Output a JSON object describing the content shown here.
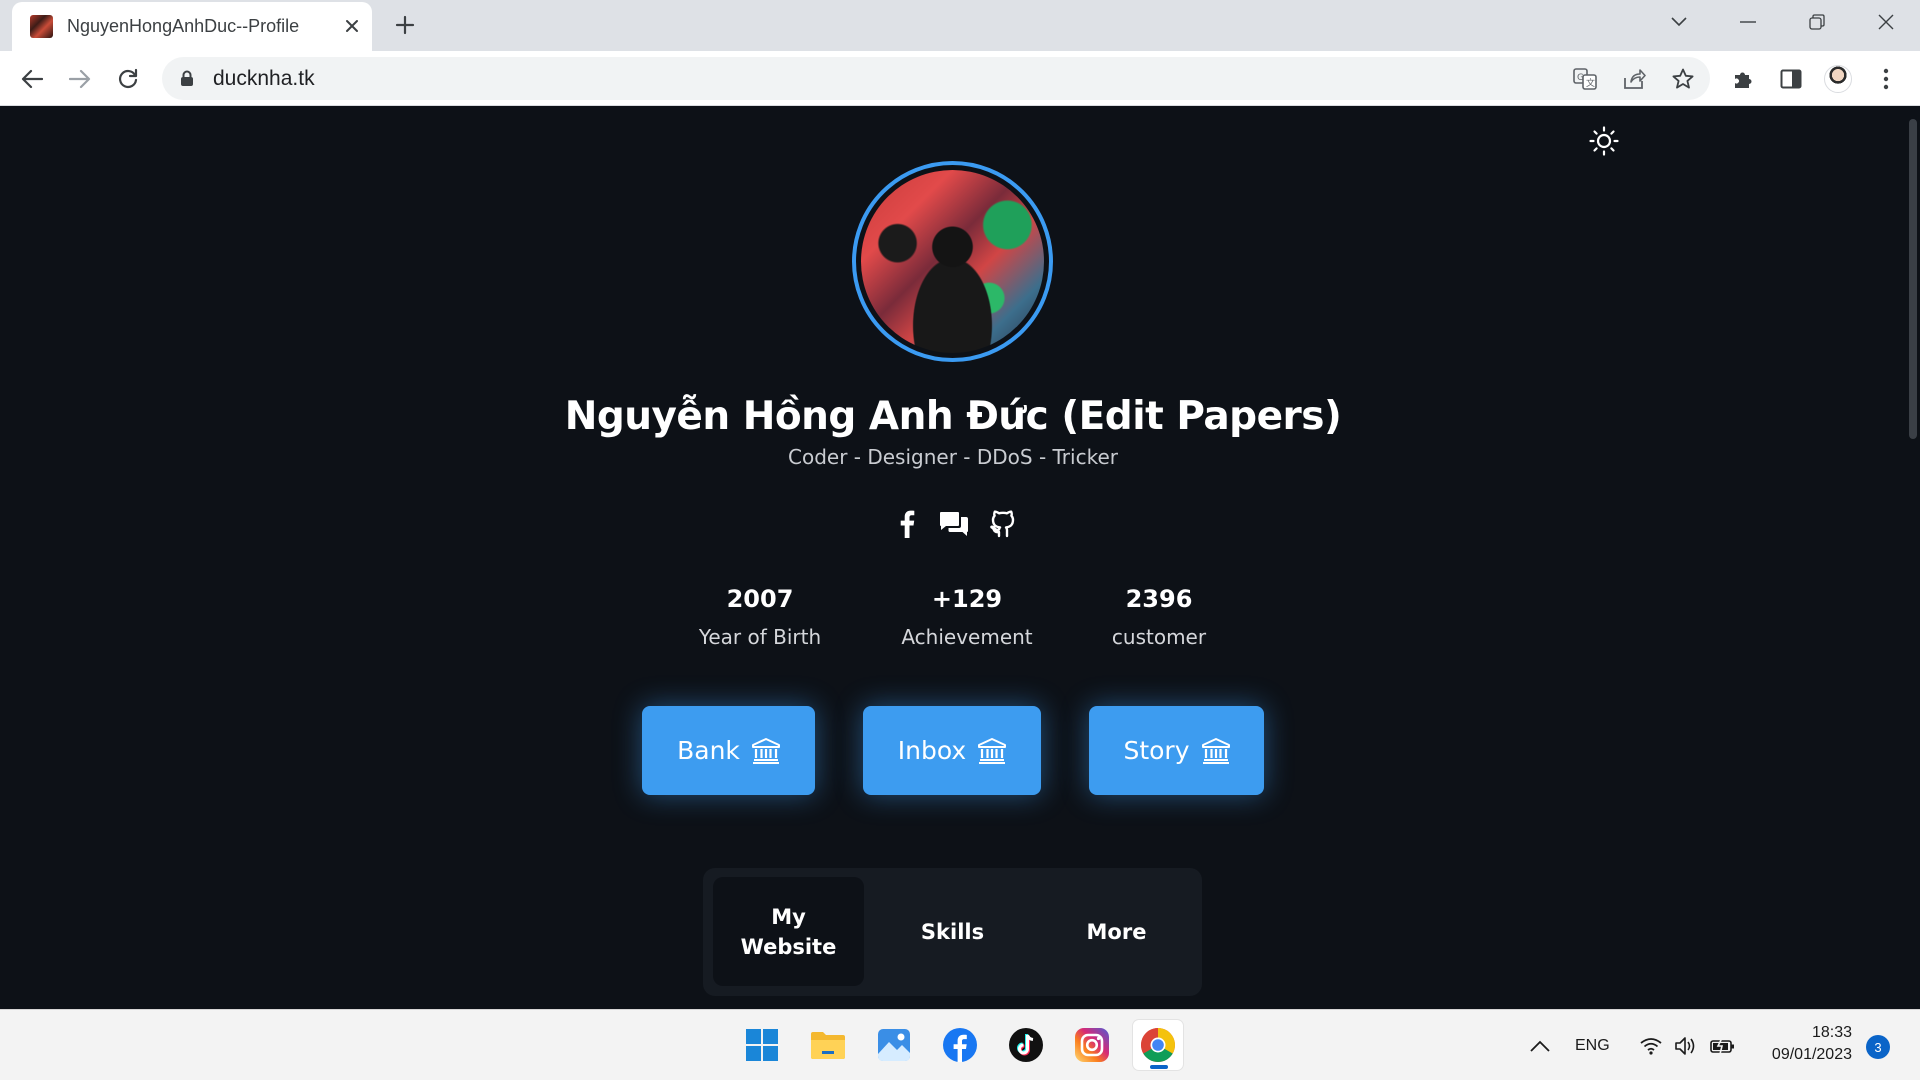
{
  "browser": {
    "tab_title": "NguyenHongAnhDuc--Profile",
    "url": "ducknha.tk",
    "icons": [
      "favicon",
      "close-icon",
      "plus-icon",
      "chevron-down-icon",
      "minimize-icon",
      "restore-icon",
      "close-window-icon",
      "back-arrow-icon",
      "forward-arrow-icon",
      "reload-icon",
      "lock-icon",
      "translate-icon",
      "share-icon",
      "star-icon",
      "puzzle-icon",
      "side-panel-icon",
      "profile-avatar",
      "kebab-menu-icon"
    ]
  },
  "profile": {
    "name": "Nguyễn Hồng Anh Đức (Edit Papers)",
    "tagline": "Coder - Designer - DDoS - Tricker",
    "socials": [
      "facebook-icon",
      "chat-icon",
      "github-icon"
    ],
    "stats": [
      {
        "value": "2007",
        "label": "Year of Birth"
      },
      {
        "value": "+129",
        "label": "Achievement"
      },
      {
        "value": "2396",
        "label": "customer"
      }
    ],
    "buttons": [
      {
        "label": "Bank",
        "icon": "bank-icon"
      },
      {
        "label": "Inbox",
        "icon": "bank-icon"
      },
      {
        "label": "Story",
        "icon": "bank-icon"
      }
    ],
    "tabs": [
      {
        "label": "My Website",
        "active": true
      },
      {
        "label": "Skills",
        "active": false
      },
      {
        "label": "More",
        "active": false
      }
    ]
  },
  "colors": {
    "accent": "#3d9cf0",
    "page_bg": "#0d1117",
    "panel_bg": "#161b22"
  },
  "taskbar": {
    "apps": [
      "windows-start-icon",
      "file-explorer-icon",
      "photos-icon",
      "facebook-app-icon",
      "tiktok-icon",
      "instagram-icon",
      "chrome-icon"
    ],
    "language": "ENG",
    "time": "18:33",
    "date": "09/01/2023",
    "notifications": "3"
  }
}
